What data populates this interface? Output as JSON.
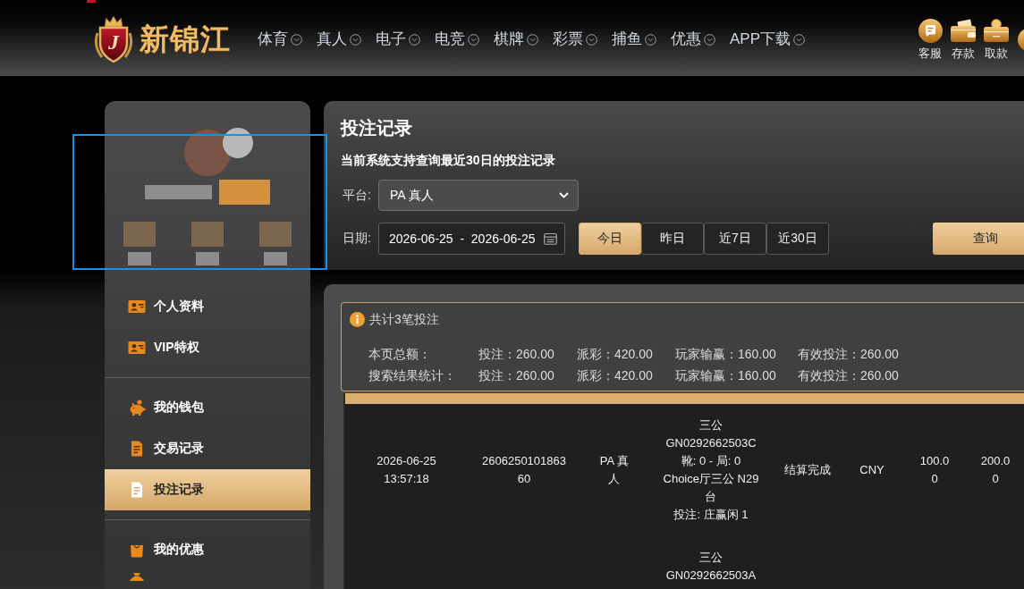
{
  "header": {
    "logo": {
      "mark": "J",
      "text": "新锦江"
    },
    "nav": [
      "体育",
      "真人",
      "电子",
      "电竞",
      "棋牌",
      "彩票",
      "捕鱼",
      "优惠",
      "APP下载"
    ],
    "quick_links": [
      "客服",
      "存款",
      "取款"
    ]
  },
  "sidebar": {
    "groups": [
      {
        "items": [
          {
            "label": "个人资料",
            "selected": false
          },
          {
            "label": "VIP特权",
            "selected": false
          }
        ]
      },
      {
        "items": [
          {
            "label": "我的钱包",
            "selected": false
          },
          {
            "label": "交易记录",
            "selected": false
          },
          {
            "label": "投注记录",
            "selected": true
          }
        ]
      },
      {
        "items": [
          {
            "label": "我的优惠",
            "selected": false
          }
        ]
      }
    ]
  },
  "page": {
    "title": "投注记录",
    "notice": "当前系统支持查询最近30日的投注记录"
  },
  "filters": {
    "platform": {
      "label": "平台:",
      "value": "PA 真人"
    },
    "date": {
      "label": "日期:",
      "value": "2026-06-25  -  2026-06-25"
    },
    "ranges": [
      {
        "label": "今日",
        "selected": true
      },
      {
        "label": "昨日",
        "selected": false
      },
      {
        "label": "近7日",
        "selected": false
      },
      {
        "label": "近30日",
        "selected": false
      }
    ],
    "search_button": "查询"
  },
  "summary": {
    "count": "共计3笔投注",
    "rows": [
      {
        "label": "本页总额：",
        "values": [
          "投注：260.00",
          "派彩：420.00",
          "玩家输赢：160.00",
          "有效投注：260.00"
        ]
      },
      {
        "label": "搜索结果统计：",
        "values": [
          "投注：260.00",
          "派彩：420.00",
          "玩家输赢：160.00",
          "有效投注：260.00"
        ]
      }
    ]
  },
  "table": {
    "rows": [
      {
        "column_1": "2026-06-25 13:57:18",
        "column_2": "260625010186360",
        "column_3": "PA 真人",
        "column_4": [
          "三公",
          "GN0292662503C",
          "靴: 0 - 局: 0",
          "Choice厅三公 N29台",
          "投注: 庄赢闲 1"
        ],
        "column_5": "结算完成",
        "column_6": "CNY",
        "column_7": "100.00",
        "column_8": "200.00"
      },
      {
        "column_4": [
          "三公",
          "GN0292662503A"
        ]
      }
    ]
  }
}
